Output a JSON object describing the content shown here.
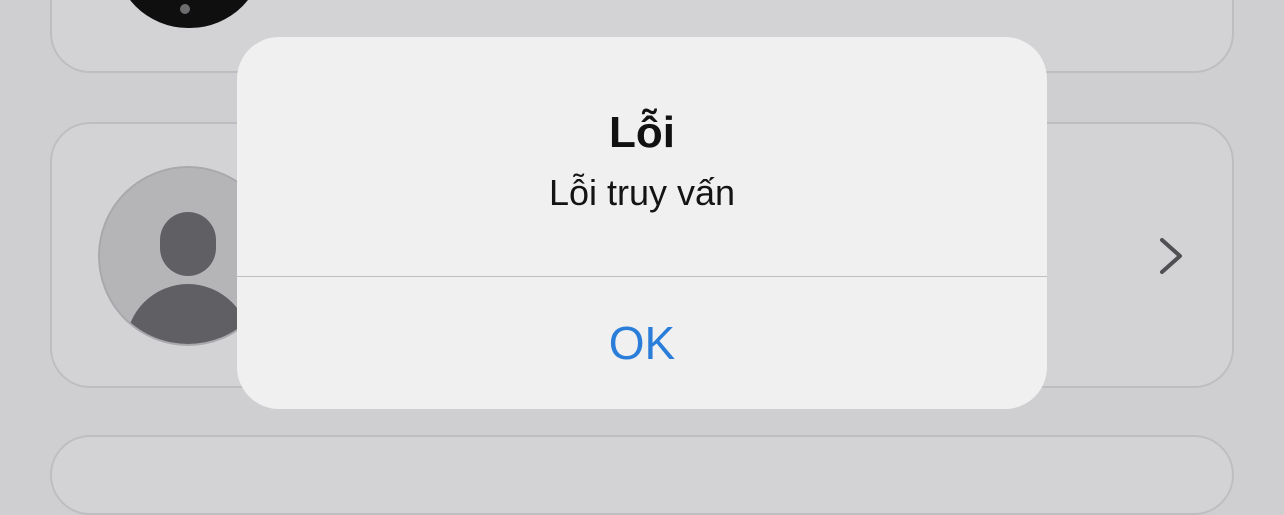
{
  "alert": {
    "title": "Lỗi",
    "message": "Lỗi truy vấn",
    "ok_label": "OK"
  },
  "icons": {
    "avatar": "person-placeholder-icon",
    "disclosure": "chevron-right-icon"
  },
  "colors": {
    "accent": "#2a7ed9",
    "alert_background": "#f0f0f0",
    "dimmed_background": "#cfcfd1"
  }
}
